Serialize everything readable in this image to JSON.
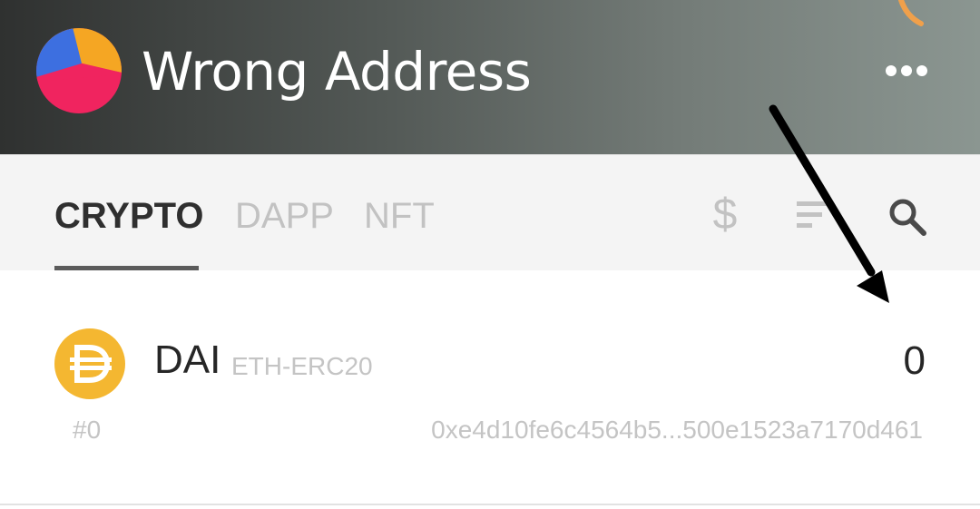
{
  "header": {
    "title": "Wrong Address",
    "more_icon": "more-dots-icon",
    "logo_colors": {
      "blue": "#3d6fe0",
      "orange": "#f5a623",
      "pink": "#f0245f"
    }
  },
  "tabs": [
    {
      "label": "CRYPTO",
      "active": true
    },
    {
      "label": "DAPP",
      "active": false
    },
    {
      "label": "NFT",
      "active": false
    }
  ],
  "toolbar": {
    "currency_symbol": "$",
    "icons": [
      "dollar-icon",
      "sort-icon",
      "search-icon"
    ]
  },
  "assets": [
    {
      "symbol": "DAI",
      "network": "ETH-ERC20",
      "balance": "0",
      "index": "#0",
      "address": "0xe4d10fe6c4564b5...500e1523a7170d461",
      "icon": "dai-coin-icon",
      "icon_color": "#f4b731"
    }
  ],
  "annotation": {
    "type": "arrow",
    "color": "#000000",
    "points_to": "balance"
  }
}
